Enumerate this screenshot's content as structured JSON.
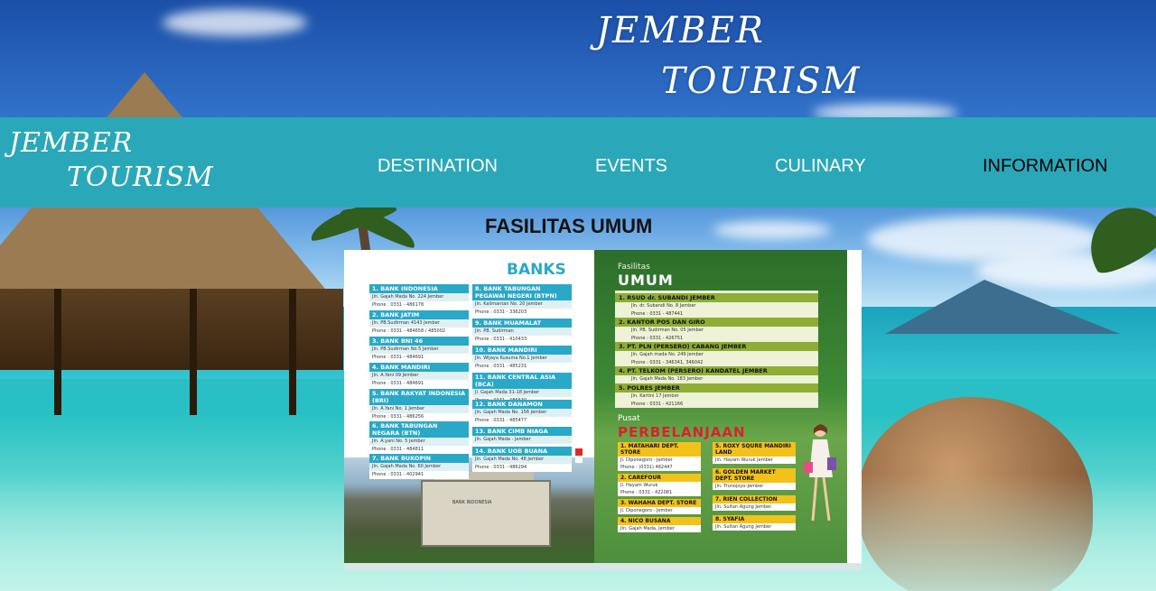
{
  "hero": {
    "title_line1": "JEMBER",
    "title_line2": "TOURISM"
  },
  "logo": {
    "line1": "JEMBER",
    "line2": "TOURISM"
  },
  "nav": {
    "items": [
      {
        "label": "DESTINATION"
      },
      {
        "label": "EVENTS"
      },
      {
        "label": "CULINARY"
      },
      {
        "label": "INFORMATION"
      }
    ]
  },
  "section": {
    "title": "FASILITAS UMUM"
  },
  "poster": {
    "banks_heading": "BANKS",
    "banks": [
      {
        "name": "1.  BANK INDONESIA",
        "addr": "Jln. Gajah Mada No. 224 Jember",
        "phone": "Phone : 0331 - 486178"
      },
      {
        "name": "2.  BANK JATIM",
        "addr": "Jln. PB.Sudirman 4143 Jember",
        "phone": "Phone : 0331 - 484658 / 485002"
      },
      {
        "name": "3.  BANK BNI 46",
        "addr": "Jln. PB.Sudirman No.5 Jember",
        "phone": "Phone : 0331 - 484691"
      },
      {
        "name": "4.  BANK MANDIRI",
        "addr": "Jln. A.Yani 09 Jember",
        "phone": "Phone : 0331 - 484691"
      },
      {
        "name": "5.  BANK RAKYAT INDONESIA (BRI)",
        "addr": "Jln. A.Yani No. 1 Jember",
        "phone": "Phone : 0331 - 486256"
      },
      {
        "name": "6.  BANK TABUNGAN NEGARA (BTN)",
        "addr": "Jln. A.yani No. 5 Jember",
        "phone": "Phone : 0331 - 484811"
      },
      {
        "name": "7.  BANK BUKOPIN",
        "addr": "Jln. Gajah Mada No. 60 Jember",
        "phone": "Phone : 0331 - 402941"
      },
      {
        "name": "8.  BANK TABUNGAN PEGAWAI NEGERI (BTPN)",
        "addr": "Jln. Kalimantan No. 20 Jember",
        "phone": "Phone : 0331 - 336203"
      },
      {
        "name": "9.  BANK MUAMALAT",
        "addr": "Jln. PB. Sudirman",
        "phone": "Phone : 0331 - 410433"
      },
      {
        "name": "10. BANK MANDIRI",
        "addr": "Jln. Wijaya Kusuma No.1 Jember",
        "phone": "Phone : 0331 - 485231"
      },
      {
        "name": "11. BANK CENTRAL ASIA (BCA)",
        "addr": "Jl. Gajah Mada 31-18 Jember",
        "phone": "Phone : 0331 - 486630"
      },
      {
        "name": "12. BANK DANAMON",
        "addr": "Jln. Gajah Mada No. 156 Jember",
        "phone": "Phone : 0331 - 485477"
      },
      {
        "name": "13. BANK CIMB NIAGA",
        "addr": "Jln. Gajah Mada - Jember",
        "phone": ""
      },
      {
        "name": "14. BANK UOB BUANA",
        "addr": "Jln. Gajah Mada No. 48 Jember",
        "phone": "Phone : 0331 - 486294"
      }
    ],
    "building_sign": "BANK INDONESIA",
    "fasilitas_small": "Fasilitas",
    "fasilitas_big": "UMUM",
    "fasilitas": [
      {
        "name": "1.  RSUD dr. SUBANDI JEMBER",
        "addr": "Jln. dr. Subandi No. 8 Jember",
        "phone": "Phone : 0331 - 487441"
      },
      {
        "name": "2.  KANTOR POS DAN GIRO",
        "addr": "Jln. PB. Sudirman No. 05 Jember",
        "phone": "Phone : 0331 - 426751"
      },
      {
        "name": "3.  PT. PLN (PERSERO) CABANG JEMBER",
        "addr": "Jln. Gajah mada No. 249 Jember",
        "phone": "Phone : 0331 - 346341, 346042"
      },
      {
        "name": "4.  PT. TELKOM (PERSERO) KANDATEL JEMBER",
        "addr": "Jln. Gajah Mada No. 183 Jember",
        "phone": ""
      },
      {
        "name": "5.  POLRES JEMBER",
        "addr": "Jln. Kartini 17 Jember",
        "phone": "Phone : 0331 - 421166"
      }
    ],
    "pusat_small": "Pusat",
    "pusat_big": "PERBELANJAAN",
    "shops": [
      {
        "name": "1. MATAHARI DEPT. STORE",
        "addr": "Jl. Diponegoro - Jember",
        "phone": "Phone : (0331) 482447"
      },
      {
        "name": "2. CAREFOUR",
        "addr": "Jl. Hayam Wuruk",
        "phone": "Phone : 0331 - 422081"
      },
      {
        "name": "3. WAHAHA DEPT. STORE",
        "addr": "Jl. Diponegoro - Jember",
        "phone": ""
      },
      {
        "name": "4. NICO BUSANA",
        "addr": "Jln. Gajah Mada, Jember",
        "phone": ""
      },
      {
        "name": "5. ROXY SQURE MANDIRI LAND",
        "addr": "Jln. Hayam Wuruk Jember",
        "phone": ""
      },
      {
        "name": "6. GOLDEN MARKET DEPT. STORE",
        "addr": "Jln. Trunojoyo-Jember",
        "phone": ""
      },
      {
        "name": "7. RIEN COLLECTION",
        "addr": "Jln. Sultan Agung Jember",
        "phone": ""
      },
      {
        "name": "8. SYAFIA",
        "addr": "Jln. Sultan Agung Jember",
        "phone": ""
      }
    ]
  },
  "colors": {
    "navbar": "#2aa8b9",
    "banks_accent": "#2aa8c7",
    "fasilitas_accent": "#8dad35",
    "shop_accent": "#f2c21b",
    "pusat_title": "#d8232a"
  }
}
